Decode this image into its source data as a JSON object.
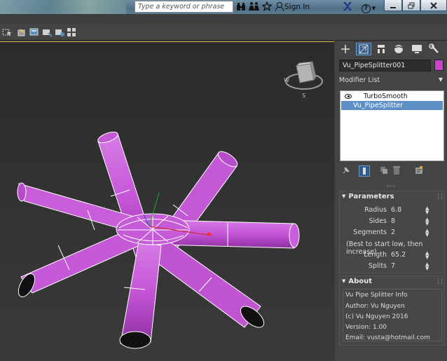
{
  "titlebar": {
    "search_placeholder": "Type a keyword or phrase",
    "sign_in": "Sign In",
    "icons": [
      "binoculars-icon",
      "community-icon",
      "star-icon",
      "user-icon",
      "exchange-icon",
      "help-icon"
    ],
    "help_glyph": "?",
    "window_controls": [
      "minimize",
      "maximize",
      "close"
    ]
  },
  "toolbar": {
    "icons": [
      "select-link-icon",
      "cube-lock-icon",
      "layer-icon",
      "layer-add-icon",
      "scene-explorer-icon",
      "grid-icon"
    ]
  },
  "viewport": {
    "object_color": "#c85bd8",
    "viewcube": {
      "labels": [
        "W",
        "S"
      ],
      "top_label": "TOP"
    }
  },
  "command_panel": {
    "tabs": [
      "create-icon",
      "modify-icon",
      "hierarchy-icon",
      "motion-icon",
      "display-icon",
      "utilities-icon"
    ],
    "active_tab": 1,
    "object_name": "Vu_PipeSplitter001",
    "object_color": "#cc44cc",
    "modifier_list_label": "Modifier List",
    "stack": [
      {
        "label": "TurboSmooth",
        "selected": false,
        "visible_toggle": true
      },
      {
        "label": "Vu_PipeSplitter",
        "selected": true,
        "visible_toggle": false
      }
    ],
    "stack_tools": [
      "pin-stack-icon",
      "show-end-result-icon",
      "make-unique-icon",
      "remove-modifier-icon",
      "configure-sets-icon"
    ],
    "parameters": {
      "title": "Parameters",
      "radius_label": "Radius",
      "radius_value": "6.8",
      "sides_label": "Sides",
      "sides_value": "8",
      "segments_label": "Segments",
      "segments_value": "2",
      "hint": "(Best to start low, then increase)",
      "length_label": "Length",
      "length_value": "65.2",
      "splits_label": "Splits",
      "splits_value": "7"
    },
    "about": {
      "title": "About",
      "info_title": "Vu Pipe Splitter Info",
      "author": "Author: Vu Nguyen",
      "copyright": "(c) Vu Nguyen 2016",
      "version": "Version: 1.00",
      "email": "Email: vusta@hotmail.com"
    }
  }
}
